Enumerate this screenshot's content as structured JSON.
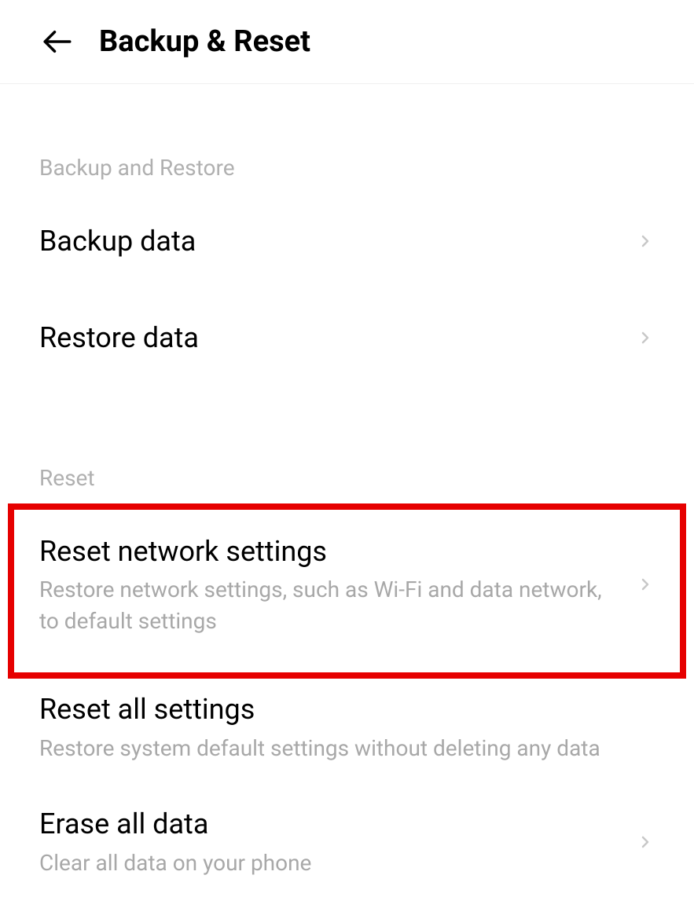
{
  "header": {
    "title": "Backup & Reset"
  },
  "sections": {
    "backup": {
      "label": "Backup and Restore",
      "items": {
        "backup_data": {
          "title": "Backup data"
        },
        "restore_data": {
          "title": "Restore data"
        }
      }
    },
    "reset": {
      "label": "Reset",
      "items": {
        "reset_network": {
          "title": "Reset network settings",
          "subtitle": "Restore network settings, such as Wi-Fi and data network, to default settings"
        },
        "reset_all": {
          "title": "Reset all settings",
          "subtitle": "Restore system default settings without deleting any data"
        },
        "erase_all": {
          "title": "Erase all data",
          "subtitle": "Clear all data on your phone"
        }
      }
    }
  }
}
